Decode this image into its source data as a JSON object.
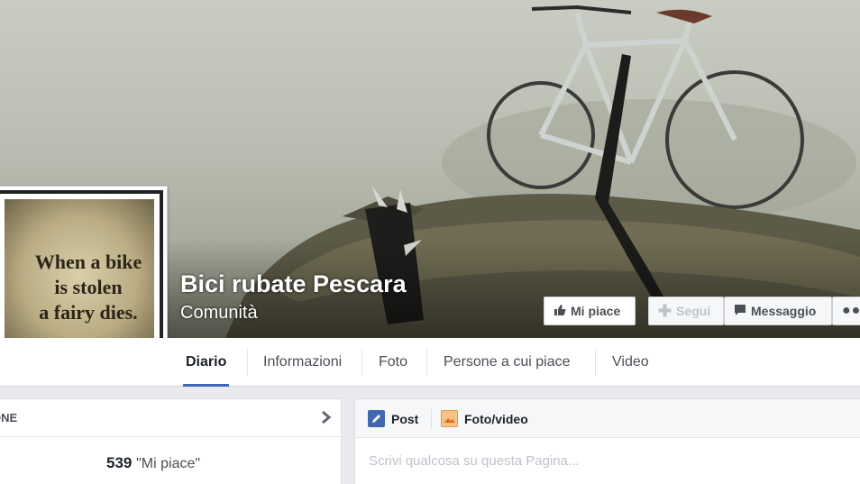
{
  "page": {
    "name": "Bici rubate Pescara",
    "category": "Comunità"
  },
  "profile_picture": {
    "quote_line1": "When a bike",
    "quote_line2": "is stolen",
    "quote_line3": "a fairy dies."
  },
  "actions": {
    "like": "Mi piace",
    "follow": "Segui",
    "message": "Messaggio"
  },
  "nav": {
    "tabs": [
      "Diario",
      "Informazioni",
      "Foto",
      "Persone a cui piace",
      "Video"
    ],
    "active": "Diario"
  },
  "left_card": {
    "title": "RSONE",
    "likes_count": "539",
    "likes_label": "\"Mi piace\""
  },
  "composer": {
    "post_tab": "Post",
    "photo_tab": "Foto/video",
    "placeholder": "Scrivi qualcosa su questa Pagina..."
  },
  "colors": {
    "accent": "#4267b2",
    "page_bg": "#e9eaed"
  }
}
